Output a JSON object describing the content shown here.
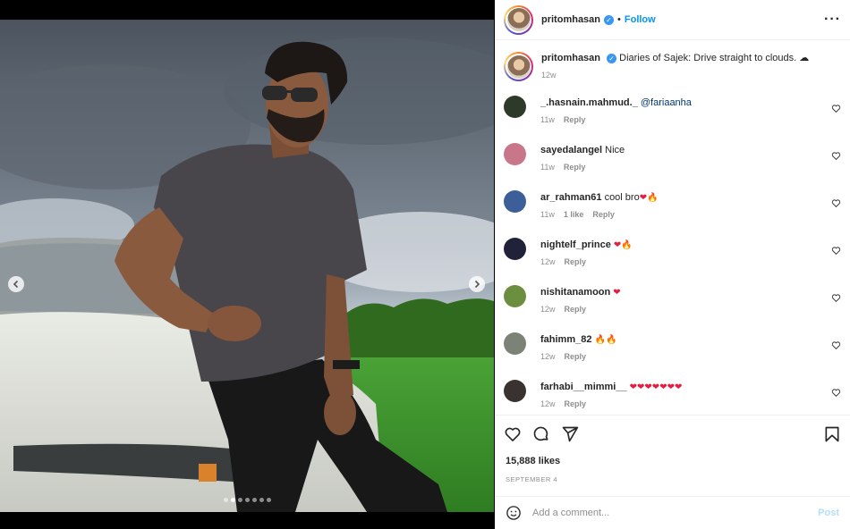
{
  "post": {
    "username": "pritomhasan",
    "follow_label": "Follow",
    "separator": "•",
    "more_glyph": "···",
    "caption_text": "Diaries of Sajek: Drive straight to clouds. ☁",
    "caption_time": "12w"
  },
  "media": {
    "slide_count": 7,
    "active_slide": 2
  },
  "comments": [
    {
      "user": "_.hasnain.mahmud._",
      "text": "",
      "mention": "@fariaanha",
      "time": "11w",
      "likes": "",
      "reply": "Reply",
      "avatar_color": "#2d3a2a"
    },
    {
      "user": "sayedalangel",
      "text": "Nice",
      "mention": "",
      "time": "11w",
      "likes": "",
      "reply": "Reply",
      "avatar_color": "#c8768a"
    },
    {
      "user": "ar_rahman61",
      "text": "cool bro",
      "emoji": "❤🔥",
      "time": "11w",
      "likes": "1 like",
      "reply": "Reply",
      "avatar_color": "#3c5f9a"
    },
    {
      "user": "nightelf_prince",
      "text": "",
      "emoji": "❤🔥",
      "time": "12w",
      "likes": "",
      "reply": "Reply",
      "avatar_color": "#1f2238"
    },
    {
      "user": "nishitanamoon",
      "text": "",
      "emoji": "❤",
      "time": "12w",
      "likes": "",
      "reply": "Reply",
      "avatar_color": "#6b8f3e"
    },
    {
      "user": "fahimm_82",
      "text": "",
      "emoji": "🔥🔥",
      "time": "12w",
      "likes": "",
      "reply": "Reply",
      "avatar_color": "#7d8277"
    },
    {
      "user": "farhabi__mimmi__",
      "text": "",
      "emoji": "❤❤❤❤❤❤❤",
      "time": "12w",
      "likes": "",
      "reply": "Reply",
      "avatar_color": "#3a3230"
    }
  ],
  "actions": {
    "likes": "15,888 likes",
    "date": "SEPTEMBER 4"
  },
  "add_comment": {
    "placeholder": "Add a comment...",
    "post_label": "Post"
  },
  "colors": {
    "accent": "#0095f6",
    "verified": "#3897f0",
    "heart": "#e41e3f"
  }
}
